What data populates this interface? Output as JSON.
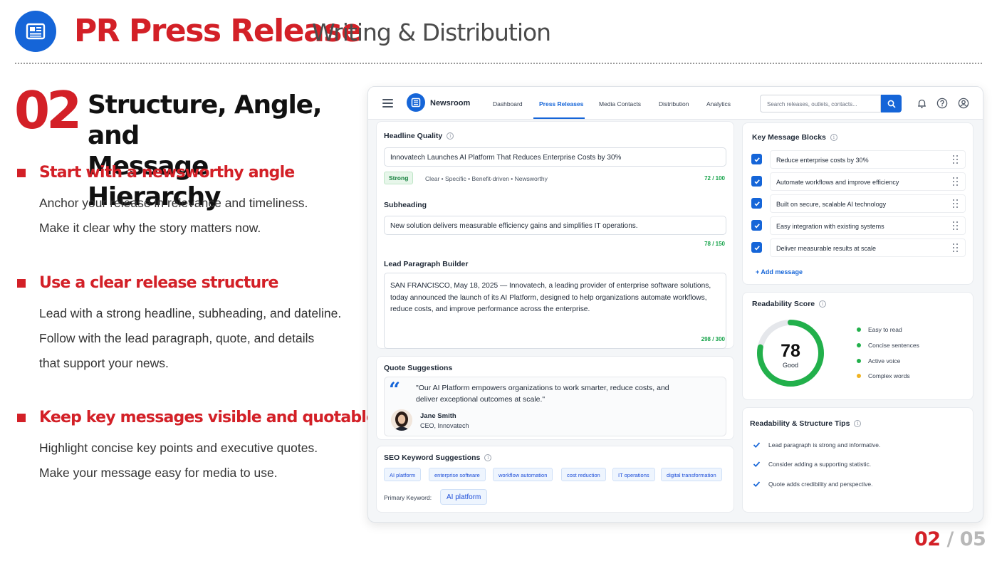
{
  "header": {
    "title": "PR Press Release",
    "subtitle": "Writing & Distribution",
    "logo_icon": "newspaper-icon"
  },
  "section": {
    "number": "02",
    "title_line1": "Structure, Angle, and",
    "title_line2": "Message Hierarchy"
  },
  "points": [
    {
      "heading": "Start with a newsworthy angle",
      "lines": [
        "Anchor your release in relevance and timeliness.",
        "Make it clear why the story matters now."
      ]
    },
    {
      "heading": "Use a clear release structure",
      "lines": [
        "Lead with a strong headline, subheading, and dateline.",
        "Follow with the lead paragraph, quote, and details",
        "that support your news."
      ]
    },
    {
      "heading": "Keep key messages visible and quotable",
      "lines": [
        "Highlight concise key points and executive quotes.",
        "Make your message easy for media to use."
      ]
    }
  ],
  "app": {
    "brand": "Newsroom",
    "nav": [
      "Dashboard",
      "Press Releases",
      "Media Contacts",
      "Distribution",
      "Analytics"
    ],
    "active_nav": "Press Releases",
    "search_placeholder": "Search releases, outlets, contacts...",
    "headline": {
      "label": "Headline Quality",
      "value": "Innovatech Launches AI Platform That Reduces Enterprise Costs by 30%",
      "badge": "Strong",
      "qualities": "Clear • Specific • Benefit-driven • Newsworthy",
      "score": "72 / 100"
    },
    "subheading": {
      "label": "Subheading",
      "value": "New solution delivers measurable efficiency gains and simplifies IT operations.",
      "count": "78 / 150"
    },
    "lead": {
      "label": "Lead Paragraph Builder",
      "value": "SAN FRANCISCO, May 18, 2025 — Innovatech, a leading provider of enterprise software solutions, today announced the launch of its AI Platform, designed to help organizations automate workflows, reduce costs, and improve performance across the enterprise.",
      "count": "298 / 300"
    },
    "quote": {
      "label": "Quote Suggestions",
      "text": "\"Our AI Platform empowers organizations to work smarter, reduce costs, and deliver exceptional outcomes at scale.\"",
      "name": "Jane Smith",
      "role": "CEO, Innovatech"
    },
    "seo": {
      "label": "SEO Keyword Suggestions",
      "keywords": [
        "AI platform",
        "enterprise software",
        "workflow automation",
        "cost reduction",
        "IT operations",
        "digital transformation"
      ],
      "primary_label": "Primary Keyword:",
      "primary_value": "AI platform"
    },
    "key_messages": {
      "label": "Key Message Blocks",
      "items": [
        "Reduce enterprise costs by 30%",
        "Automate workflows and improve efficiency",
        "Built on secure, scalable AI technology",
        "Easy integration with existing systems",
        "Deliver measurable results at scale"
      ],
      "add_label": "+ Add message"
    },
    "readability": {
      "label": "Readability Score",
      "score": "78",
      "score_value": 78,
      "grade": "Good",
      "ring_color": "#22b04b",
      "legend": [
        {
          "text": "Easy to read",
          "color": "#22b04b"
        },
        {
          "text": "Concise sentences",
          "color": "#22b04b"
        },
        {
          "text": "Active voice",
          "color": "#22b04b"
        },
        {
          "text": "Complex words",
          "color": "#f0b323"
        }
      ]
    },
    "tips": {
      "label": "Readability & Structure Tips",
      "items": [
        "Lead paragraph is strong and informative.",
        "Consider adding a supporting statistic.",
        "Quote adds credibility and perspective."
      ]
    }
  },
  "pager": {
    "current": "02",
    "separator": "/",
    "total": "05"
  },
  "colors": {
    "accent_red": "#d32027",
    "brand_blue": "#1565d8",
    "success_green": "#16a34a"
  }
}
